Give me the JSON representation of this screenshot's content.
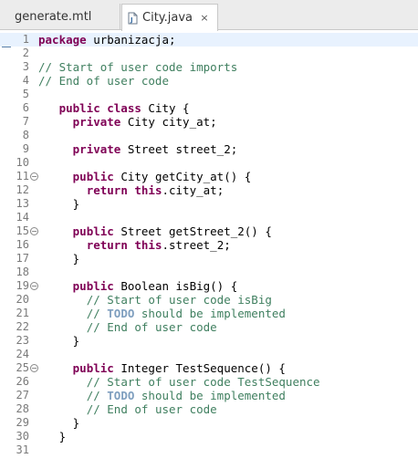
{
  "tabs": [
    {
      "label": "generate.mtl",
      "active": false
    },
    {
      "label": "City.java",
      "active": true,
      "close": "×"
    }
  ],
  "colors": {
    "keyword": "#7f0055",
    "comment": "#3f7f5f",
    "todo": "#7f9fbf",
    "current_line": "#e8f2fe"
  },
  "editor": {
    "lines": [
      {
        "n": "1",
        "indent": "",
        "parts": [
          {
            "t": "kw",
            "v": "package"
          },
          {
            "t": "tx",
            "v": " urbanizacja;"
          }
        ]
      },
      {
        "n": "2",
        "indent": "",
        "parts": []
      },
      {
        "n": "3",
        "indent": "",
        "parts": [
          {
            "t": "cm",
            "v": "// Start of user code imports"
          }
        ]
      },
      {
        "n": "4",
        "indent": "",
        "parts": [
          {
            "t": "cm",
            "v": "// End of user code"
          }
        ]
      },
      {
        "n": "5",
        "indent": "",
        "parts": []
      },
      {
        "n": "6",
        "indent": "   ",
        "parts": [
          {
            "t": "kw",
            "v": "public class"
          },
          {
            "t": "tx",
            "v": " City {"
          }
        ]
      },
      {
        "n": "7",
        "indent": "     ",
        "parts": [
          {
            "t": "kw",
            "v": "private"
          },
          {
            "t": "tx",
            "v": " City city_at;"
          }
        ]
      },
      {
        "n": "8",
        "indent": "",
        "parts": []
      },
      {
        "n": "9",
        "indent": "     ",
        "parts": [
          {
            "t": "kw",
            "v": "private"
          },
          {
            "t": "tx",
            "v": " Street street_2;"
          }
        ]
      },
      {
        "n": "10",
        "indent": "",
        "parts": []
      },
      {
        "n": "11",
        "fold": true,
        "indent": "     ",
        "parts": [
          {
            "t": "kw",
            "v": "public"
          },
          {
            "t": "tx",
            "v": " City getCity_at() {"
          }
        ]
      },
      {
        "n": "12",
        "indent": "       ",
        "parts": [
          {
            "t": "kw",
            "v": "return this"
          },
          {
            "t": "tx",
            "v": ".city_at;"
          }
        ]
      },
      {
        "n": "13",
        "indent": "     ",
        "parts": [
          {
            "t": "tx",
            "v": "}"
          }
        ]
      },
      {
        "n": "14",
        "indent": "",
        "parts": []
      },
      {
        "n": "15",
        "fold": true,
        "indent": "     ",
        "parts": [
          {
            "t": "kw",
            "v": "public"
          },
          {
            "t": "tx",
            "v": " Street getStreet_2() {"
          }
        ]
      },
      {
        "n": "16",
        "indent": "       ",
        "parts": [
          {
            "t": "kw",
            "v": "return this"
          },
          {
            "t": "tx",
            "v": ".street_2;"
          }
        ]
      },
      {
        "n": "17",
        "indent": "     ",
        "parts": [
          {
            "t": "tx",
            "v": "}"
          }
        ]
      },
      {
        "n": "18",
        "indent": "",
        "parts": []
      },
      {
        "n": "19",
        "fold": true,
        "indent": "     ",
        "parts": [
          {
            "t": "kw",
            "v": "public"
          },
          {
            "t": "tx",
            "v": " Boolean isBig() {"
          }
        ]
      },
      {
        "n": "20",
        "indent": "       ",
        "parts": [
          {
            "t": "cm",
            "v": "// Start of user code isBig"
          }
        ]
      },
      {
        "n": "21",
        "indent": "       ",
        "parts": [
          {
            "t": "cm",
            "v": "// "
          },
          {
            "t": "todo",
            "v": "TODO"
          },
          {
            "t": "cm",
            "v": " should be implemented"
          }
        ]
      },
      {
        "n": "22",
        "indent": "       ",
        "parts": [
          {
            "t": "cm",
            "v": "// End of user code"
          }
        ]
      },
      {
        "n": "23",
        "indent": "     ",
        "parts": [
          {
            "t": "tx",
            "v": "}"
          }
        ]
      },
      {
        "n": "24",
        "indent": "",
        "parts": []
      },
      {
        "n": "25",
        "fold": true,
        "indent": "     ",
        "parts": [
          {
            "t": "kw",
            "v": "public"
          },
          {
            "t": "tx",
            "v": " Integer TestSequence() {"
          }
        ]
      },
      {
        "n": "26",
        "indent": "       ",
        "parts": [
          {
            "t": "cm",
            "v": "// Start of user code TestSequence"
          }
        ]
      },
      {
        "n": "27",
        "indent": "       ",
        "parts": [
          {
            "t": "cm",
            "v": "// "
          },
          {
            "t": "todo",
            "v": "TODO"
          },
          {
            "t": "cm",
            "v": " should be implemented"
          }
        ]
      },
      {
        "n": "28",
        "indent": "       ",
        "parts": [
          {
            "t": "cm",
            "v": "// End of user code"
          }
        ]
      },
      {
        "n": "29",
        "indent": "     ",
        "parts": [
          {
            "t": "tx",
            "v": "}"
          }
        ]
      },
      {
        "n": "30",
        "indent": "   ",
        "parts": [
          {
            "t": "tx",
            "v": "}"
          }
        ]
      },
      {
        "n": "31",
        "indent": "",
        "parts": []
      }
    ]
  }
}
